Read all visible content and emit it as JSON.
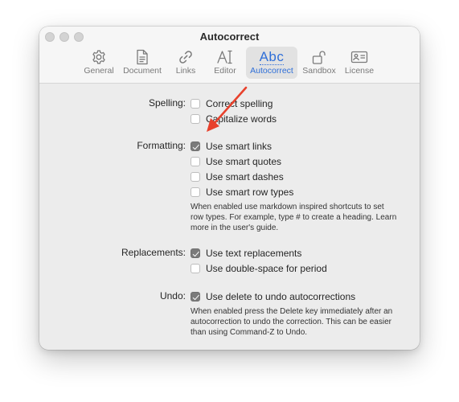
{
  "window": {
    "title": "Autocorrect"
  },
  "tabs": [
    {
      "label": "General",
      "icon": "gear-icon",
      "selected": false
    },
    {
      "label": "Document",
      "icon": "document-icon",
      "selected": false
    },
    {
      "label": "Links",
      "icon": "link-icon",
      "selected": false
    },
    {
      "label": "Editor",
      "icon": "text-cursor-icon",
      "selected": false
    },
    {
      "label": "Autocorrect",
      "icon": "abc-spellcheck-icon",
      "icon_text": "Abc",
      "selected": true
    },
    {
      "label": "Sandbox",
      "icon": "unlocked-padlock-icon",
      "selected": false
    },
    {
      "label": "License",
      "icon": "id-card-icon",
      "selected": false
    }
  ],
  "colors": {
    "accent": "#2f6fd8",
    "annotation_arrow": "#e8412c",
    "window_bg": "#ececec",
    "toolbar_bg": "#f6f6f6"
  },
  "spelling": {
    "label": "Spelling:",
    "options": [
      {
        "label": "Correct spelling",
        "checked": false
      },
      {
        "label": "Capitalize words",
        "checked": false
      }
    ]
  },
  "formatting": {
    "label": "Formatting:",
    "options": [
      {
        "label": "Use smart links",
        "checked": true
      },
      {
        "label": "Use smart quotes",
        "checked": false
      },
      {
        "label": "Use smart dashes",
        "checked": false
      },
      {
        "label": "Use smart row types",
        "checked": false
      }
    ],
    "help_lines": [
      "When enabled use markdown inspired shortcuts to set",
      "row types. For example, type # to create a heading. Learn",
      "more in the user's guide."
    ]
  },
  "replacements": {
    "label": "Replacements:",
    "options": [
      {
        "label": "Use text replacements",
        "checked": true
      },
      {
        "label": "Use double-space for period",
        "checked": false
      }
    ]
  },
  "undo": {
    "label": "Undo:",
    "options": [
      {
        "label": "Use delete to undo autocorrections",
        "checked": true
      }
    ],
    "help_lines": [
      "When enabled press the Delete key immediately after an",
      "autocorrection to undo the correction. This can be easier",
      "than using Command-Z to Undo."
    ]
  }
}
